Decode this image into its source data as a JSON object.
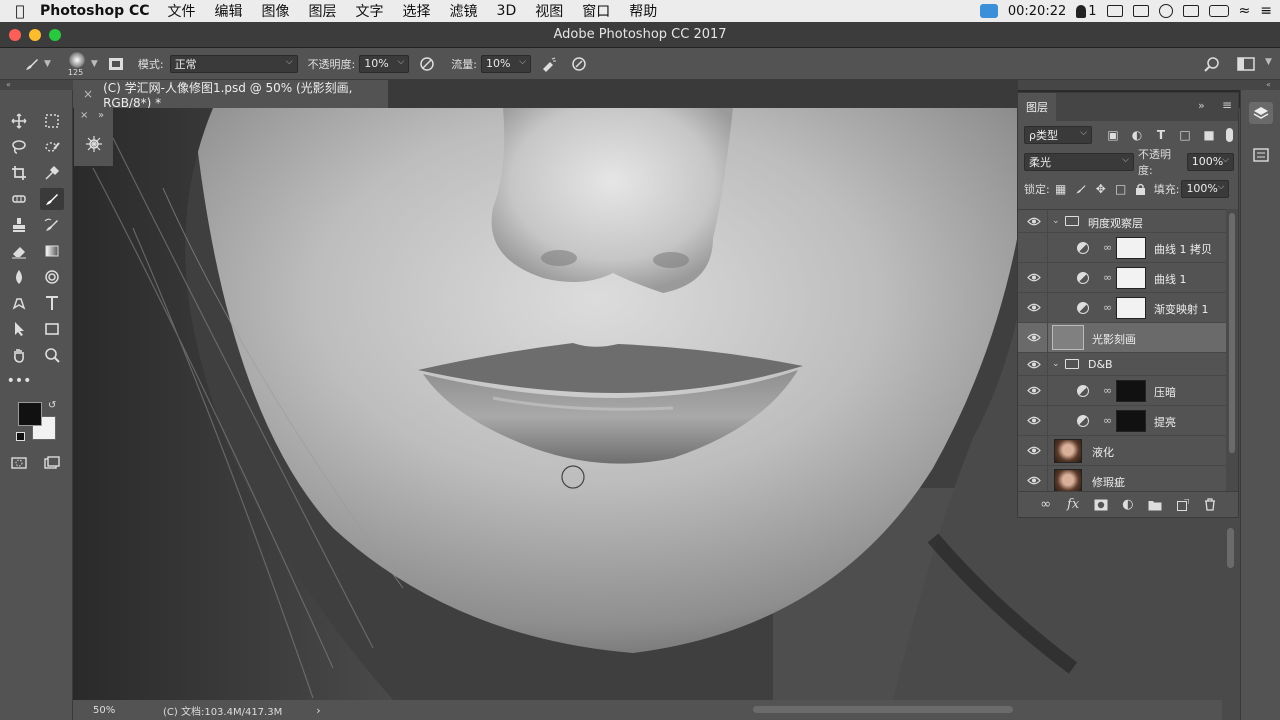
{
  "menubar": {
    "app": "Photoshop CC",
    "items": [
      "文件",
      "编辑",
      "图像",
      "图层",
      "文字",
      "选择",
      "滤镜",
      "3D",
      "视图",
      "窗口",
      "帮助"
    ],
    "clock": "00:20:22",
    "notify_count": "1"
  },
  "window": {
    "title": "Adobe Photoshop CC 2017"
  },
  "options": {
    "brush_size": "125",
    "mode_label": "模式:",
    "mode_value": "正常",
    "opacity_label": "不透明度:",
    "opacity_value": "10%",
    "flow_label": "流量:",
    "flow_value": "10%"
  },
  "document": {
    "tab_title": "(C) 学汇网-人像修图1.psd @ 50% (光影刻画, RGB/8*) *",
    "zoom": "50%",
    "doc_info": "(C) 文档:103.4M/417.3M"
  },
  "layers_panel": {
    "tab": "图层",
    "filter_label": "ρ类型",
    "blend_mode": "柔光",
    "opacity_label": "不透明度:",
    "opacity_value": "100%",
    "lock_label": "锁定:",
    "fill_label": "填充:",
    "fill_value": "100%",
    "layers": [
      {
        "name": "明度观察层",
        "type": "group",
        "visible": true
      },
      {
        "name": "曲线 1 拷贝",
        "type": "adjustment",
        "visible": false,
        "thumb": "white"
      },
      {
        "name": "曲线 1",
        "type": "adjustment",
        "visible": true,
        "thumb": "white"
      },
      {
        "name": "渐变映射 1",
        "type": "adjustment",
        "visible": true,
        "thumb": "white"
      },
      {
        "name": "光影刻画",
        "type": "pixel",
        "visible": true,
        "selected": true,
        "thumb": "gray"
      },
      {
        "name": "D&B",
        "type": "group",
        "visible": true
      },
      {
        "name": "压暗",
        "type": "adjustment",
        "visible": true,
        "thumb": "black"
      },
      {
        "name": "提亮",
        "type": "adjustment",
        "visible": true,
        "thumb": "black"
      },
      {
        "name": "液化",
        "type": "pixel",
        "visible": true,
        "thumb": "portrait"
      },
      {
        "name": "修瑕疵",
        "type": "pixel",
        "visible": true,
        "thumb": "portrait"
      }
    ]
  },
  "colors": {
    "ui_dark": "#535353",
    "foreground": "#111111",
    "background": "#f2f2f2"
  }
}
